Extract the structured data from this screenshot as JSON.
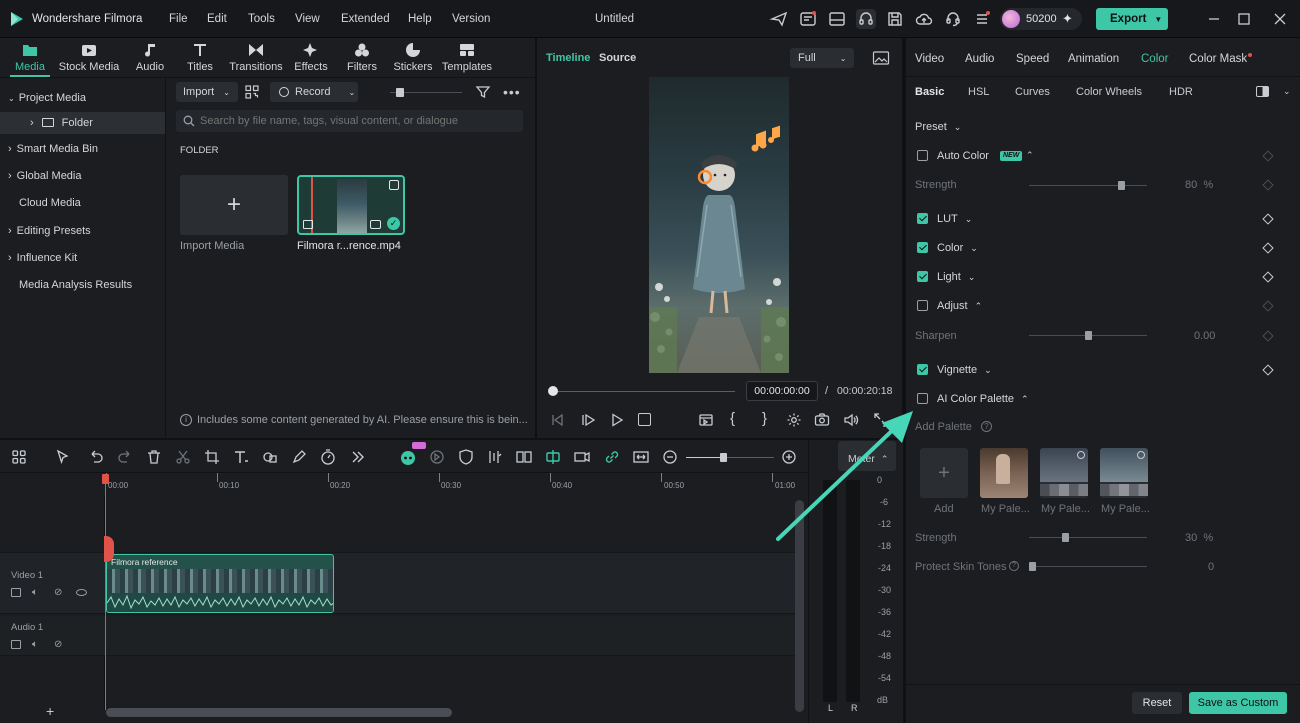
{
  "app": {
    "name": "Wondershare Filmora",
    "title": "Untitled"
  },
  "menu": [
    "File",
    "Edit",
    "Tools",
    "View",
    "Extended",
    "Help",
    "Version"
  ],
  "account": {
    "credits": "50200"
  },
  "export_label": "Export",
  "nav_tabs": [
    {
      "label": "Media",
      "icon": "media-icon"
    },
    {
      "label": "Stock Media",
      "icon": "stock-media-icon"
    },
    {
      "label": "Audio",
      "icon": "music-note-icon"
    },
    {
      "label": "Titles",
      "icon": "text-t-icon"
    },
    {
      "label": "Transitions",
      "icon": "bowtie-transition-icon"
    },
    {
      "label": "Effects",
      "icon": "sparkle-effects-icon"
    },
    {
      "label": "Filters",
      "icon": "filter-circles-icon"
    },
    {
      "label": "Stickers",
      "icon": "sticker-icon"
    },
    {
      "label": "Templates",
      "icon": "template-grid-icon"
    }
  ],
  "sidebar": {
    "items": [
      {
        "label": "Project Media"
      },
      {
        "label": "Folder"
      },
      {
        "label": "Smart Media Bin"
      },
      {
        "label": "Global Media"
      },
      {
        "label": "Cloud Media"
      },
      {
        "label": "Editing Presets"
      },
      {
        "label": "Influence Kit"
      },
      {
        "label": "Media Analysis Results"
      }
    ]
  },
  "media": {
    "import_label": "Import",
    "record_label": "Record",
    "search_placeholder": "Search by file name, tags, visual content, or dialogue",
    "folder_heading": "FOLDER",
    "import_media_label": "Import Media",
    "clip_name": "Filmora r...rence.mp4",
    "ai_notice": "Includes some content generated by AI. Please ensure this is bein..."
  },
  "preview": {
    "tab_timeline": "Timeline",
    "tab_source": "Source",
    "quality": "Full",
    "current_time": "00:00:00:00",
    "separator": "/",
    "total_time": "00:00:20:18",
    "progress": 0
  },
  "right_panel": {
    "tabs": [
      "Video",
      "Audio",
      "Speed",
      "Animation",
      "Color",
      "Color Mask"
    ],
    "active_tab": "Color",
    "subtabs": [
      "Basic",
      "HSL",
      "Curves",
      "Color Wheels",
      "HDR"
    ],
    "preset_label": "Preset",
    "auto_color": {
      "label": "Auto Color",
      "badge": "NEW",
      "checked": false
    },
    "strength": {
      "label": "Strength",
      "value": "80",
      "unit": "%",
      "level": 0.8
    },
    "lut": {
      "label": "LUT",
      "checked": true
    },
    "color": {
      "label": "Color",
      "checked": true
    },
    "light": {
      "label": "Light",
      "checked": true
    },
    "adjust": {
      "label": "Adjust",
      "checked": false
    },
    "sharpen": {
      "label": "Sharpen",
      "value": "0.00",
      "level": 0.5
    },
    "vignette": {
      "label": "Vignette",
      "checked": true
    },
    "ai_palette": {
      "label": "AI Color Palette",
      "checked": false
    },
    "add_palette_label": "Add Palette",
    "palette_items": [
      {
        "label": "Add"
      },
      {
        "label": "My Pale..."
      },
      {
        "label": "My Pale..."
      },
      {
        "label": "My Pale..."
      }
    ],
    "palette_strength": {
      "label": "Strength",
      "value": "30",
      "unit": "%",
      "level": 0.3
    },
    "protect_skin": {
      "label": "Protect Skin Tones",
      "value": "0",
      "level": 0
    },
    "reset_label": "Reset",
    "save_custom_label": "Save as Custom"
  },
  "timeline": {
    "ruler": [
      "00:00",
      "00:10",
      "00:20",
      "00:30",
      "00:40",
      "00:50",
      "01:00"
    ],
    "meter_label": "Meter",
    "meter_scale": [
      "0",
      "-6",
      "-12",
      "-18",
      "-24",
      "-30",
      "-36",
      "-42",
      "-48",
      "-54",
      "dB"
    ],
    "meter_channels": [
      "L",
      "R"
    ],
    "tracks": [
      {
        "label": "Video 1"
      },
      {
        "label": "Audio 1"
      }
    ],
    "clip_label": "Filmora reference"
  },
  "colors": {
    "accent": "#3ec7a7",
    "bg": "#0f1113",
    "panel": "#1b1d20",
    "arrow": "#48d6b8"
  }
}
